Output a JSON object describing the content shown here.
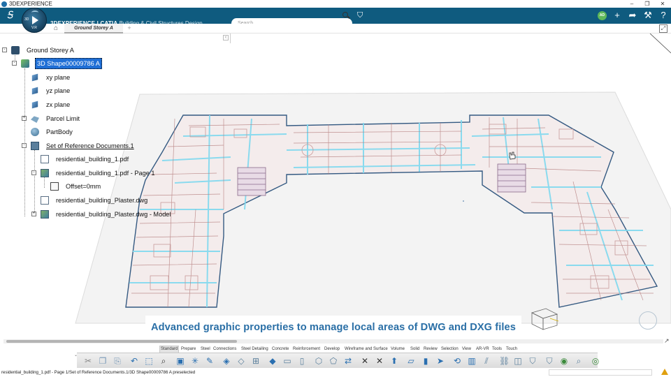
{
  "window": {
    "title": "3DEXPERIENCE"
  },
  "app": {
    "brand": "3DEXPERIENCE | CATIA",
    "subtitle": "Building & Civil Structures Design",
    "compass_label": "3D",
    "compass_version": "V.R",
    "avatar_initials": "AD",
    "search_placeholder": "Search"
  },
  "tabs": {
    "active": "Ground Storey A",
    "add": "+"
  },
  "tree": {
    "root": "Ground Storey A",
    "selected": "3D Shape00009786 A",
    "items": [
      {
        "label": "xy plane"
      },
      {
        "label": "yz plane"
      },
      {
        "label": "zx plane"
      },
      {
        "label": "Parcel Limit"
      },
      {
        "label": "PartBody"
      },
      {
        "label": "Set of Reference Documents.1"
      },
      {
        "label": "residential_building_1.pdf"
      },
      {
        "label": "residential_building_1.pdf - Page 1"
      },
      {
        "label": "Offset=0mm"
      },
      {
        "label": "residential_building_Plaster.dwg"
      },
      {
        "label": "residential_building_Plaster.dwg - Model"
      }
    ]
  },
  "caption": "Advanced graphic properties to manage local areas of DWG and DXG files",
  "action_tabs": [
    "Standard",
    "Prepare",
    "Steel",
    "Connections",
    "Steel Detailing",
    "Concrete",
    "Reinforcement",
    "Develop",
    "Wireframe and Surface",
    "Volume",
    "Solid",
    "Review",
    "Selection",
    "View",
    "AR-VR",
    "Tools",
    "Touch"
  ],
  "active_action_tab": "Standard",
  "toolbar_icons": [
    "cut-icon",
    "copy-icon",
    "paste-icon",
    "undo-icon",
    "select-icon",
    "zoom-icon",
    "frame-icon",
    "snap-icon",
    "edit-icon",
    "layer-icon",
    "plane-icon",
    "grid-icon",
    "wall-icon",
    "slab-icon",
    "box-icon",
    "shape-icon",
    "door-icon",
    "mirror-icon",
    "cross-icon",
    "cross2-icon",
    "pin-icon",
    "beam-icon",
    "column-icon",
    "arrow-icon",
    "twist-icon",
    "ruler-icon",
    "split-icon",
    "link-icon",
    "view-icon",
    "tag-icon",
    "tag2-icon",
    "globe-icon",
    "measure-icon",
    "render-icon"
  ],
  "status_text": "residential_building_1.pdf - Page 1/Set of Reference Documents.1/3D Shape00009786 A preselected",
  "colors": {
    "header": "#0f5b7f",
    "selection": "#1f6fd6",
    "caption": "#2a6fa6",
    "wall_highlight": "#7fd9ef",
    "floorplan_line": "#b37a7a"
  }
}
